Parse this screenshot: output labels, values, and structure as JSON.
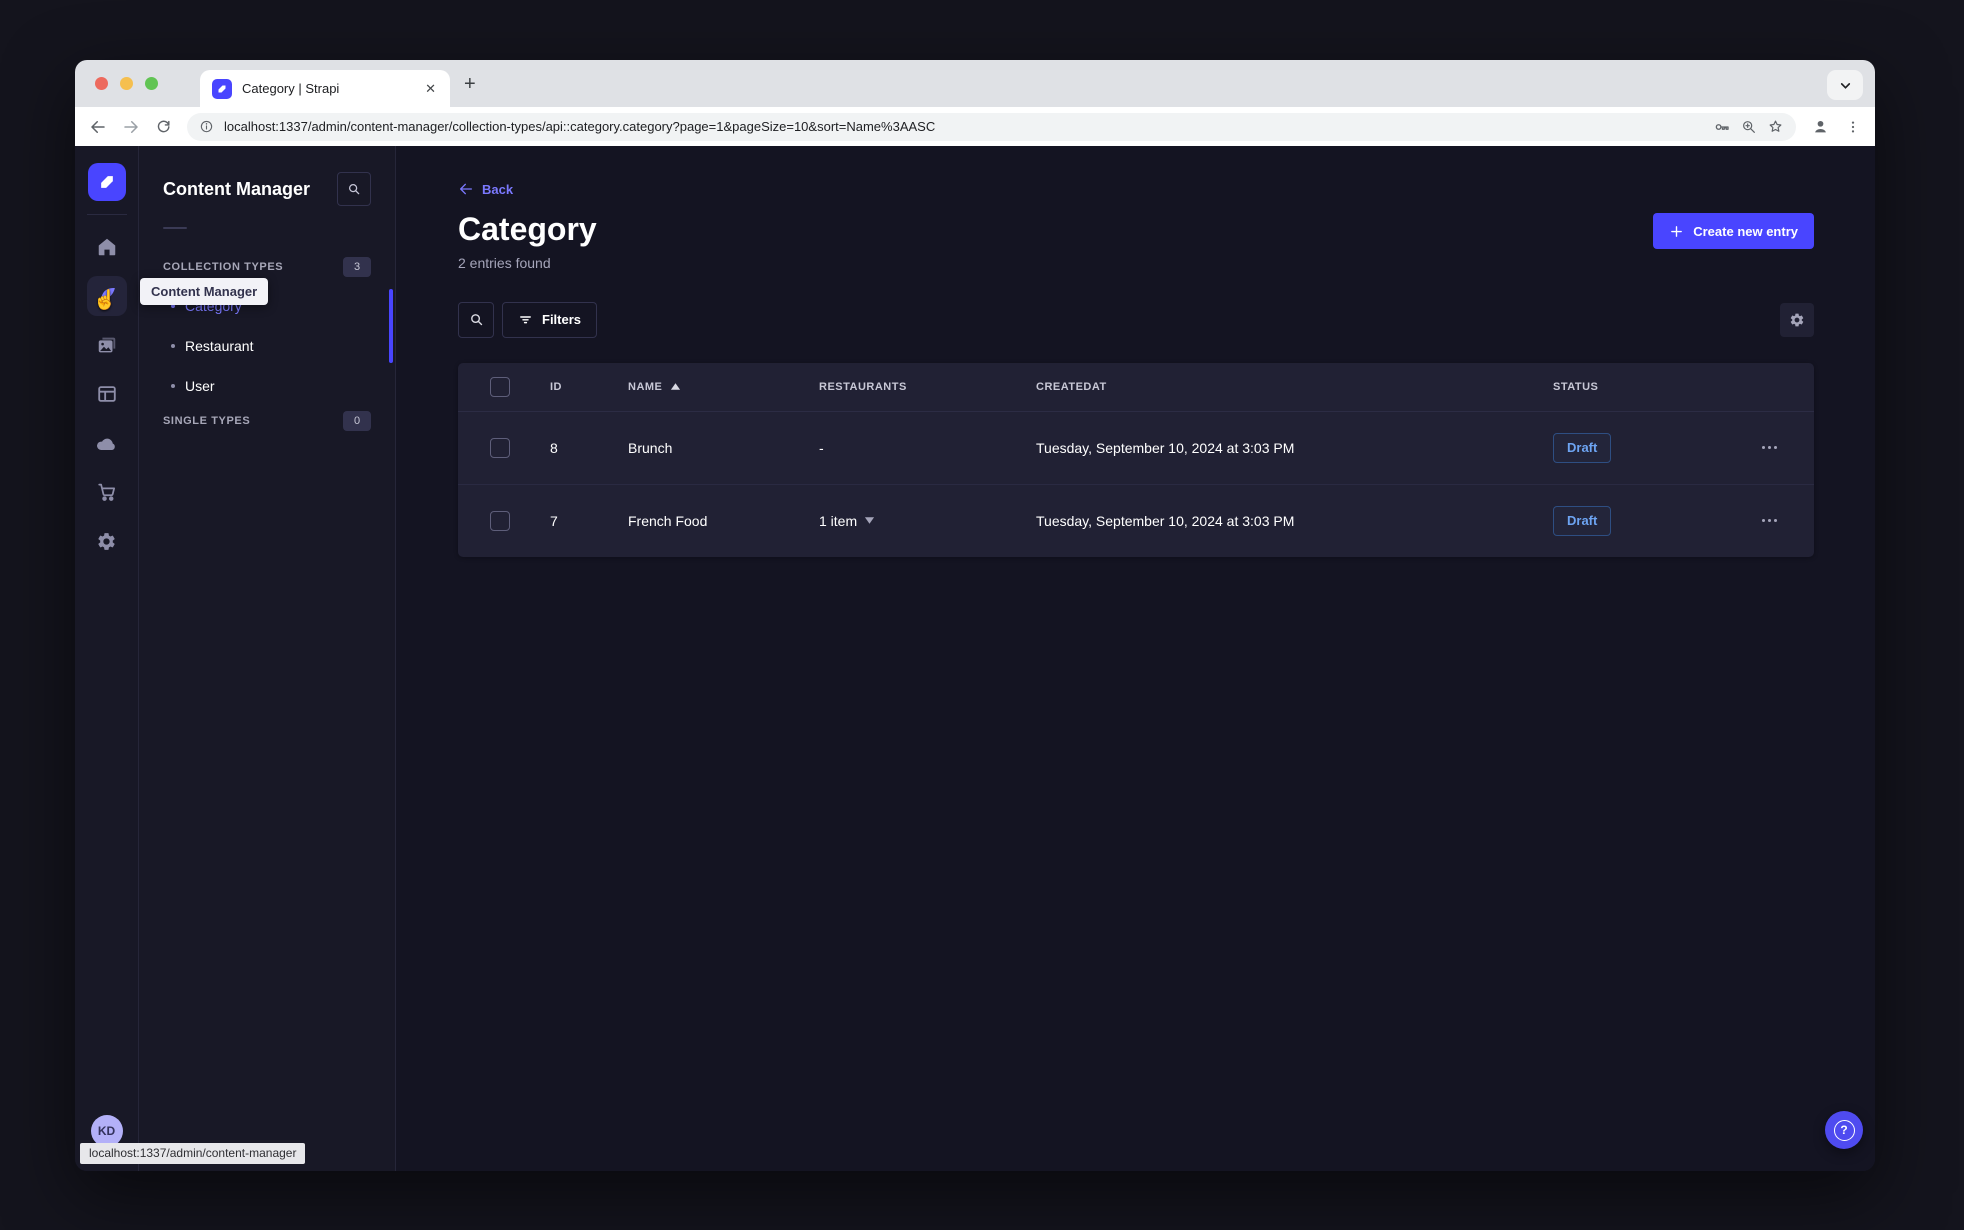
{
  "browser": {
    "tab_title": "Category | Strapi",
    "url": "localhost:1337/admin/content-manager/collection-types/api::category.category?page=1&pageSize=10&sort=Name%3AASC"
  },
  "icons": {
    "close_tab": "✕",
    "new_tab": "+",
    "question": "?",
    "hand_cursor": "☝"
  },
  "colors": {
    "accent": "#4945ff",
    "active_link": "#7b79ff",
    "draft_status": "#6da4f2",
    "traffic_red": "#ed6a5e",
    "traffic_yellow": "#f5bf4f",
    "traffic_green": "#61c454"
  },
  "app_rail": {
    "tooltip": "Content Manager",
    "avatar_initials": "KD"
  },
  "content_sidebar": {
    "title": "Content Manager",
    "collection_types_label": "COLLECTION TYPES",
    "collection_types_count": "3",
    "items": [
      {
        "label": "Category"
      },
      {
        "label": "Restaurant"
      },
      {
        "label": "User"
      }
    ],
    "single_types_label": "SINGLE TYPES",
    "single_types_count": "0"
  },
  "main": {
    "back_label": "Back",
    "title": "Category",
    "subtitle": "2 entries found",
    "create_button_label": "Create new entry",
    "filters_button_label": "Filters"
  },
  "table": {
    "columns": [
      "ID",
      "NAME",
      "RESTAURANTS",
      "CREATEDAT",
      "STATUS"
    ],
    "rows": [
      {
        "id": "8",
        "name": "Brunch",
        "restaurants": "-",
        "createdat": "Tuesday, September 10, 2024 at 3:03 PM",
        "status": "Draft"
      },
      {
        "id": "7",
        "name": "French Food",
        "restaurants": "1 item",
        "createdat": "Tuesday, September 10, 2024 at 3:03 PM",
        "status": "Draft"
      }
    ]
  },
  "footer": {
    "status_link": "localhost:1337/admin/content-manager"
  }
}
